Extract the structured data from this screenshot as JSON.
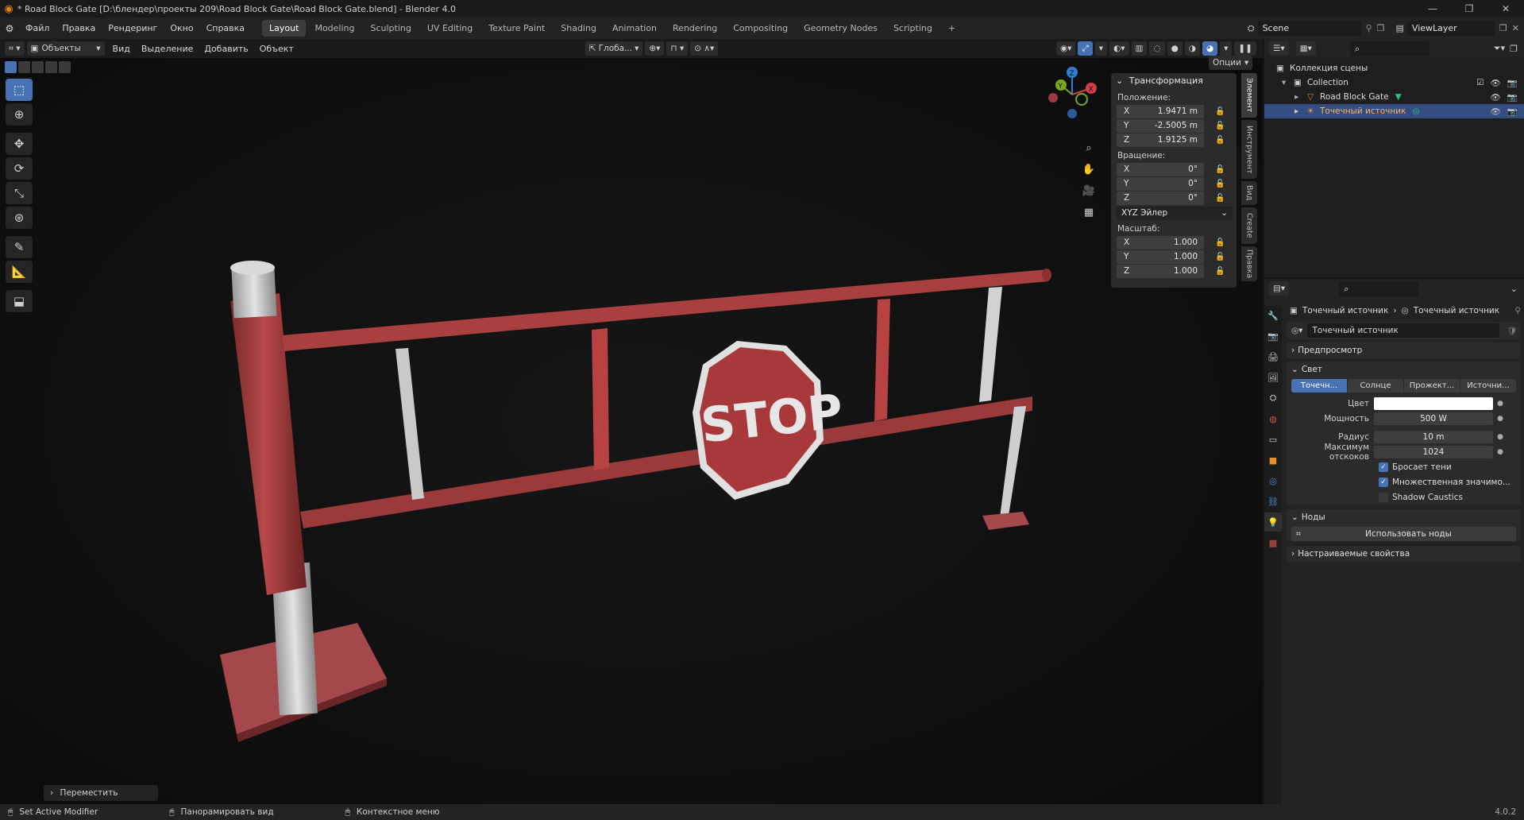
{
  "window": {
    "title": "* Road Block Gate [D:\\блендер\\проекты 209\\Road Block Gate\\Road Block Gate.blend] - Blender 4.0",
    "controls": [
      "—",
      "❐",
      "✕"
    ]
  },
  "menubar": {
    "menus": [
      "Файл",
      "Правка",
      "Рендеринг",
      "Окно",
      "Справка"
    ],
    "workspaces": [
      "Layout",
      "Modeling",
      "Sculpting",
      "UV Editing",
      "Texture Paint",
      "Shading",
      "Animation",
      "Rendering",
      "Compositing",
      "Geometry Nodes",
      "Scripting"
    ],
    "active_workspace": "Layout",
    "add_tab": "+",
    "scene": "Scene",
    "view_layer": "ViewLayer"
  },
  "viewport": {
    "mode": "Объекты",
    "menus": [
      "Вид",
      "Выделение",
      "Добавить",
      "Объект"
    ],
    "transform_orientation": "Глоба...",
    "options_label": "Опции",
    "gizmo": {
      "x": "X",
      "y": "Y",
      "z": "Z"
    },
    "last_operator": "Переместить",
    "scene_text": "STOP"
  },
  "npanel": {
    "title": "Трансформация",
    "location_label": "Положение:",
    "location": [
      {
        "axis": "X",
        "value": "1.9471 m"
      },
      {
        "axis": "Y",
        "value": "-2.5005 m"
      },
      {
        "axis": "Z",
        "value": "1.9125 m"
      }
    ],
    "rotation_label": "Вращение:",
    "rotation": [
      {
        "axis": "X",
        "value": "0°"
      },
      {
        "axis": "Y",
        "value": "0°"
      },
      {
        "axis": "Z",
        "value": "0°"
      }
    ],
    "rotation_mode": "XYZ Эйлер",
    "scale_label": "Масштаб:",
    "scale": [
      {
        "axis": "X",
        "value": "1.000"
      },
      {
        "axis": "Y",
        "value": "1.000"
      },
      {
        "axis": "Z",
        "value": "1.000"
      }
    ],
    "tabs": [
      "Элемент",
      "Инструмент",
      "Вид",
      "Create",
      "Правка"
    ]
  },
  "outliner": {
    "scene_collection": "Коллекция сцены",
    "items": [
      {
        "name": "Collection",
        "selected": false
      },
      {
        "name": "Road Block Gate",
        "selected": false
      },
      {
        "name": "Точечный источник",
        "selected": true
      }
    ]
  },
  "properties": {
    "breadcrumb": [
      "Точечный источник",
      "Точечный источник"
    ],
    "data_name": "Точечный источник",
    "sections": {
      "preview": "Предпросмотр",
      "light": "Свет",
      "nodes": "Ноды",
      "custom": "Настраиваемые свойства"
    },
    "light_types": [
      "Точечн...",
      "Солнце",
      "Прожект...",
      "Источни..."
    ],
    "active_light_type": "Точечн...",
    "fields": [
      {
        "label": "Цвет",
        "value": ""
      },
      {
        "label": "Мощность",
        "value": "500 W"
      },
      {
        "label": "Радиус",
        "value": "10 m"
      },
      {
        "label": "Максимум отскоков",
        "value": "1024"
      }
    ],
    "checkboxes": [
      {
        "label": "Бросает тени",
        "checked": true
      },
      {
        "label": "Множественная значимо...",
        "checked": true
      },
      {
        "label": "Shadow Caustics",
        "checked": false
      }
    ],
    "use_nodes_button": "Использовать ноды"
  },
  "statusbar": {
    "items": [
      "Set Active Modifier",
      "Панорамировать вид",
      "Контекстное меню"
    ],
    "version": "4.0.2"
  },
  "colors": {
    "accent": "#4772b3",
    "selected_row": "#334d80",
    "barrier_red": "#a83a3a",
    "orange": "#e87d0d"
  }
}
